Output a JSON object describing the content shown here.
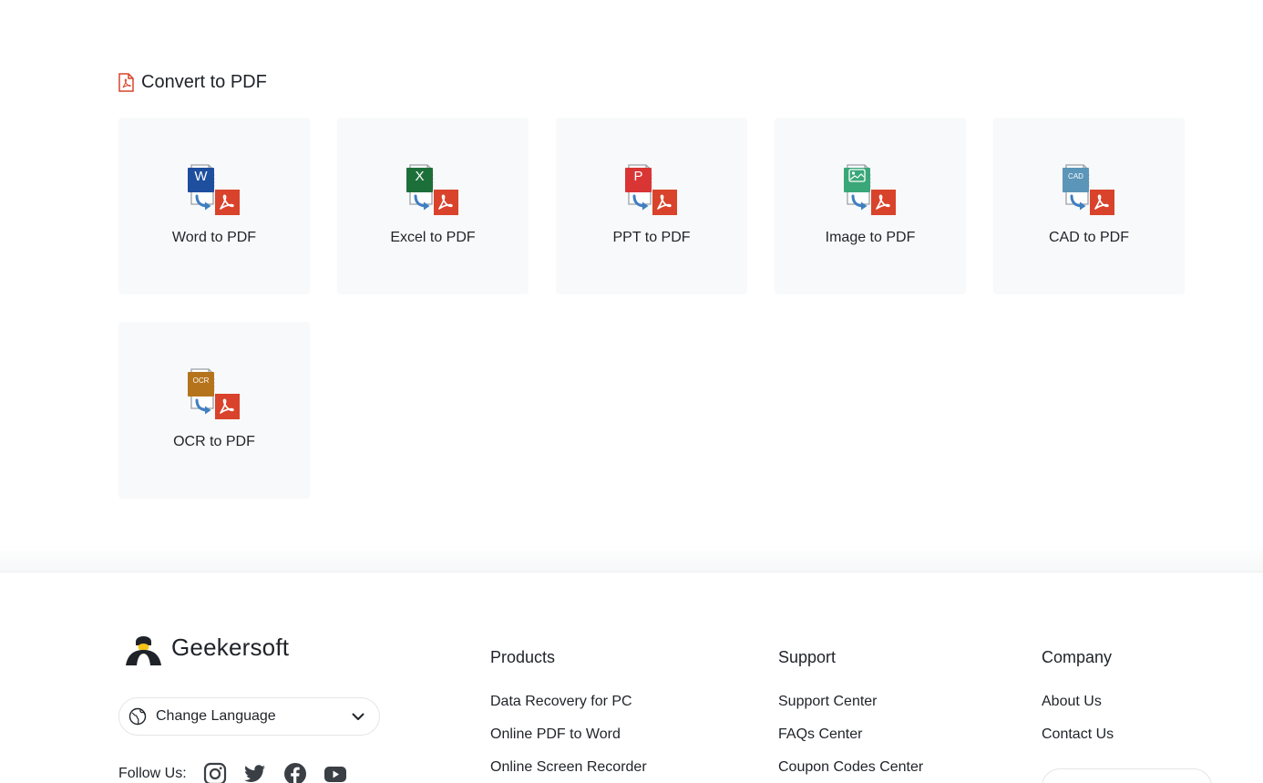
{
  "section": {
    "title": "Convert to PDF",
    "cards": [
      {
        "label": "Word to PDF",
        "icon": "word-to-pdf-icon",
        "badge": "W",
        "color": "#1e4e9e"
      },
      {
        "label": "Excel to PDF",
        "icon": "excel-to-pdf-icon",
        "badge": "X",
        "color": "#1d6f3a"
      },
      {
        "label": "PPT to PDF",
        "icon": "ppt-to-pdf-icon",
        "badge": "P",
        "color": "#d93535"
      },
      {
        "label": "Image to PDF",
        "icon": "image-to-pdf-icon",
        "badge": "",
        "color": "#3aa779"
      },
      {
        "label": "CAD to PDF",
        "icon": "cad-to-pdf-icon",
        "badge": "CAD",
        "color": "#5b95b8"
      },
      {
        "label": "OCR to PDF",
        "icon": "ocr-to-pdf-icon",
        "badge": "OCR",
        "color": "#b5741c"
      }
    ]
  },
  "footer": {
    "brand": "Geekersoft",
    "language": {
      "label": "Change Language"
    },
    "follow_label": "Follow Us:",
    "social": [
      "instagram-icon",
      "twitter-icon",
      "facebook-icon",
      "youtube-icon"
    ],
    "columns": [
      {
        "title": "Products",
        "links": [
          "Data Recovery for PC",
          "Online PDF to Word",
          "Online Screen Recorder"
        ]
      },
      {
        "title": "Support",
        "links": [
          "Support Center",
          "FAQs Center",
          "Coupon Codes Center"
        ]
      },
      {
        "title": "Company",
        "links": [
          "About Us",
          "Contact Us"
        ]
      }
    ]
  },
  "colors": {
    "pdf_red": "#d9432b",
    "arrow_blue": "#3f7fc1",
    "card_bg": "#f8f9fa"
  }
}
